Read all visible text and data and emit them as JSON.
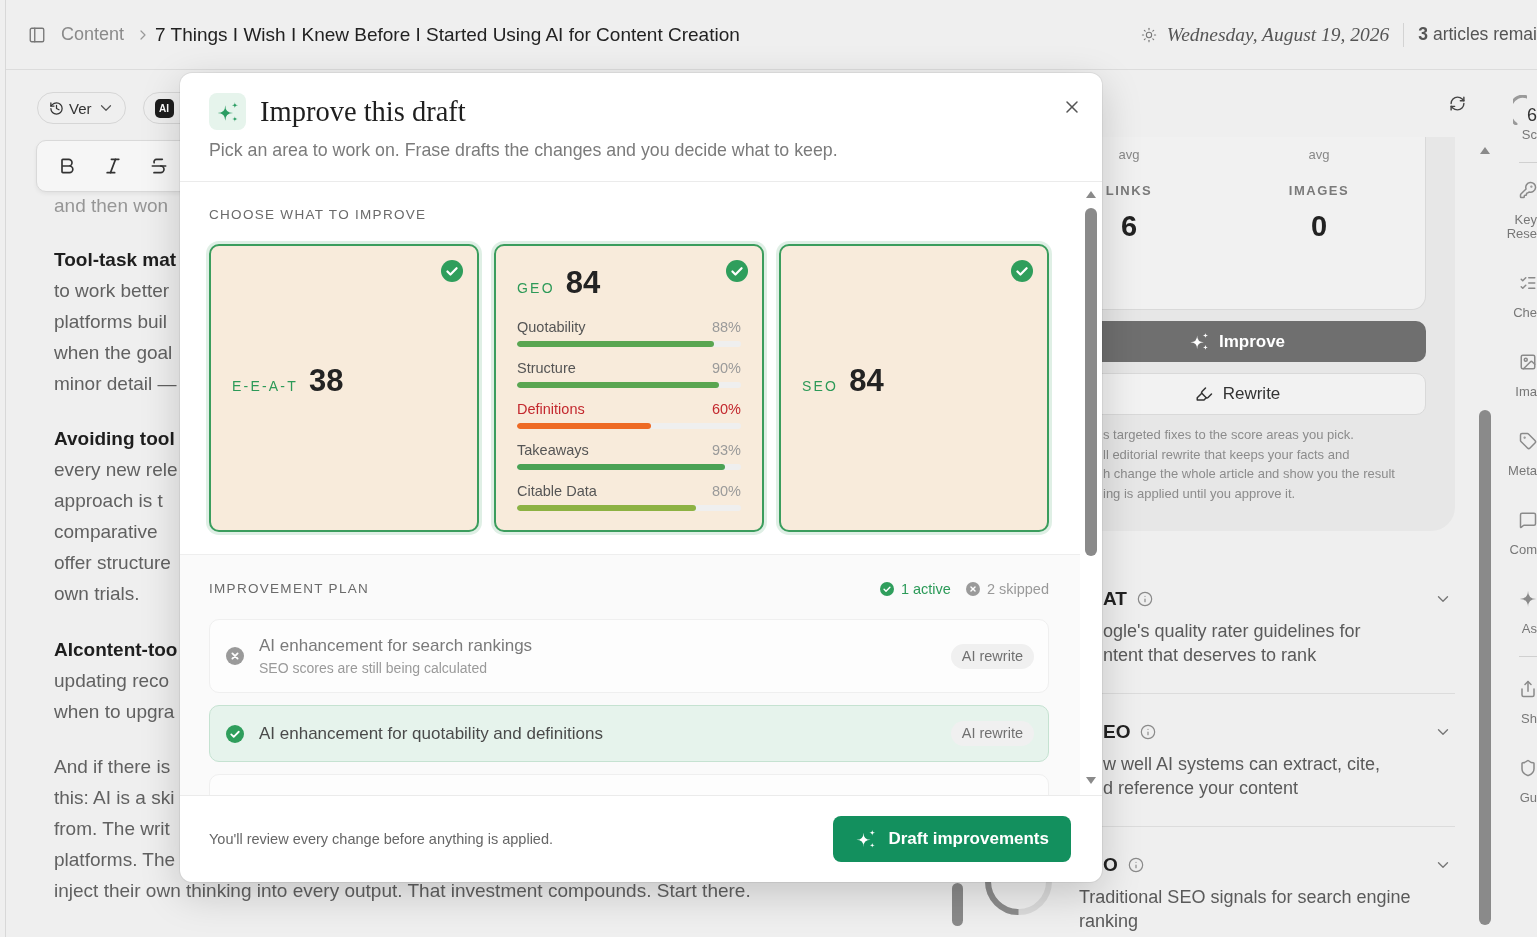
{
  "topbar": {
    "breadcrumb": {
      "parent": "Content",
      "current": "7 Things I Wish I Knew Before I Started Using AI for Content Creation"
    },
    "date": "Wednesday, August 19, 2026",
    "quota": "**3** articles remai"
  },
  "editor": {
    "version_button": "Ver",
    "ai_button": "AI",
    "faded_line": "and then won",
    "paragraphs": [
      {
        "lead": "Tool-task mat",
        "lines": [
          "to work better",
          "platforms buil",
          "when the goal",
          "minor detail —"
        ]
      },
      {
        "lead": "Avoiding tool",
        "lines": [
          "every new rele",
          "approach is t",
          "comparative",
          "offer structure",
          "own trials."
        ]
      },
      {
        "lead": "AIcontent-too",
        "lines": [
          "updating reco",
          "when to upgra"
        ]
      },
      {
        "lines": [
          "And if there is",
          "this: AI is a ski",
          "from. The writ",
          "platforms. The",
          "inject their own thinking into every output. That investment compounds. Start there."
        ]
      }
    ]
  },
  "score_panel": {
    "stats": {
      "units": [
        "avg",
        "avg"
      ],
      "cells": [
        {
          "label": "LINKS",
          "value": "6"
        },
        {
          "label": "IMAGES",
          "value": "0"
        }
      ]
    },
    "actions": [
      {
        "kind": "primary",
        "label": "Improve"
      },
      {
        "kind": "secondary",
        "label": "Rewrite"
      }
    ],
    "note_lines": [
      "s targeted fixes to the score areas you pick.",
      "ll editorial rewrite that keeps your facts and",
      "h change the whole article and show you the result",
      "ing is applied until you approve it."
    ],
    "sections": [
      {
        "kind": "covered",
        "title": "AT",
        "expanded": false,
        "lines": [
          "ogle's quality rater guidelines for",
          "ntent that deserves to rank"
        ]
      },
      {
        "kind": "covered",
        "title": "EO",
        "expanded": false,
        "lines": [
          "w well AI systems can extract, cite,",
          "d reference your content"
        ]
      },
      {
        "kind": "partly_covered",
        "title": "O",
        "expanded": false,
        "text": "Traditional SEO signals for search engine ranking"
      }
    ]
  },
  "rail": {
    "groups": [
      [
        {
          "kind": "score",
          "value": "6",
          "label_lines": [
            "Sc"
          ]
        }
      ],
      [
        {
          "kind": "tool",
          "label_lines": [
            "Key",
            "Rese"
          ]
        },
        {
          "kind": "tool",
          "label_lines": [
            "Che"
          ]
        },
        {
          "kind": "tool",
          "label_lines": [
            "Ima"
          ]
        },
        {
          "kind": "tool",
          "label_lines": [
            "Meta"
          ]
        },
        {
          "kind": "tool",
          "label_lines": [
            "Com"
          ]
        },
        {
          "kind": "tool",
          "label_lines": [
            "As"
          ]
        }
      ],
      [
        {
          "kind": "tool",
          "label_lines": [
            "Sh"
          ]
        },
        {
          "kind": "tool",
          "label_lines": [
            "Gu"
          ]
        }
      ]
    ]
  },
  "modal": {
    "title": "Improve this draft",
    "subtitle": "Pick an area to work on. Frase drafts the changes and you decide what to keep.",
    "choose_label": "CHOOSE WHAT TO IMPROVE",
    "areas": [
      {
        "label": "E-E-A-T",
        "score": "38",
        "selected": true
      },
      {
        "label": "GEO",
        "score": "84",
        "selected": true,
        "metrics": [
          {
            "name": "Quotability",
            "value": "88%",
            "level": 0.88,
            "color": "#5aa651",
            "flagged": false
          },
          {
            "name": "Structure",
            "value": "90%",
            "level": 0.9,
            "color": "#5aa651",
            "flagged": false
          },
          {
            "name": "Definitions",
            "value": "60%",
            "level": 0.6,
            "color": "#ee6a23",
            "flagged": true
          },
          {
            "name": "Takeaways",
            "value": "93%",
            "level": 0.93,
            "color": "#4aa255",
            "flagged": false
          },
          {
            "name": "Citable Data",
            "value": "80%",
            "level": 0.8,
            "color": "#8db243",
            "flagged": false
          }
        ]
      },
      {
        "label": "SEO",
        "score": "84",
        "selected": true
      }
    ],
    "plan": {
      "label": "IMPROVEMENT PLAN",
      "active": "1 active",
      "skipped": "2 skipped",
      "items": [
        {
          "title": "AI enhancement for search rankings",
          "detail": "SEO scores are still being calculated",
          "badge": "AI rewrite",
          "selected": false
        },
        {
          "title": "AI enhancement for quotability and definitions",
          "badge": "AI rewrite",
          "selected": true
        }
      ],
      "more_below": true
    },
    "footer_note": "You'll review every change before anything is applied.",
    "submit": "Draft improvements"
  }
}
